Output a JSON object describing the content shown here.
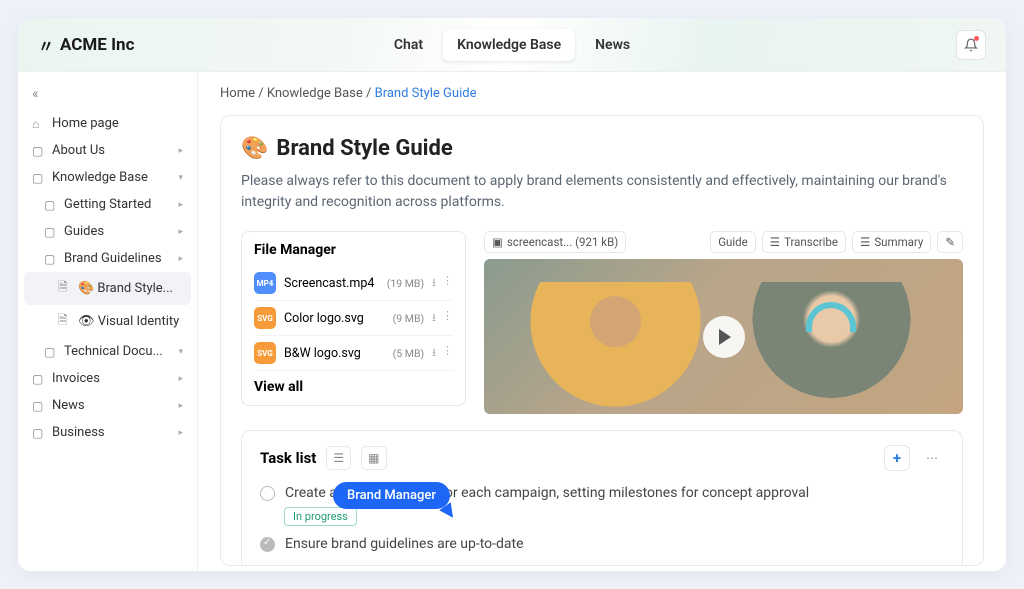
{
  "brand": "ACME Inc",
  "nav": {
    "chat": "Chat",
    "kb": "Knowledge Base",
    "news": "News"
  },
  "crumbs": {
    "home": "Home",
    "kb": "Knowledge Base",
    "current": "Brand Style Guide"
  },
  "sidebar": {
    "home": "Home page",
    "about": "About Us",
    "kb": "Knowledge Base",
    "getting_started": "Getting Started",
    "guides": "Guides",
    "brand_guidelines": "Brand Guidelines",
    "brand_style": "🎨 Brand Style...",
    "visual_identity": "👁 Visual Identity",
    "technical": "Technical Docu...",
    "invoices": "Invoices",
    "news": "News",
    "business": "Business"
  },
  "page": {
    "title": "Brand Style Guide",
    "emoji": "🎨",
    "desc": "Please always refer to this document to apply brand elements consistently and effectively, maintaining our brand's integrity and recognition across platforms."
  },
  "fm": {
    "title": "File Manager",
    "files": [
      {
        "type": "MP4",
        "name": "Screencast.mp4",
        "size": "(19 MB)"
      },
      {
        "type": "SVG",
        "name": "Color logo.svg",
        "size": "(9 MB)"
      },
      {
        "type": "SVG",
        "name": "B&W logo.svg",
        "size": "(5 MB)"
      }
    ],
    "view_all": "View all"
  },
  "video": {
    "file_label": "screencast... (921 kB)",
    "guide": "Guide",
    "transcribe": "Transcribe",
    "summary": "Summary"
  },
  "tasks": {
    "title": "Task list",
    "items": [
      {
        "label": "Create a project timeline for each campaign, setting milestones for concept approval",
        "status": "In progress",
        "done": false
      },
      {
        "label": "Ensure brand guidelines are up-to-date",
        "done": true
      }
    ]
  },
  "tooltip": "Brand Manager"
}
